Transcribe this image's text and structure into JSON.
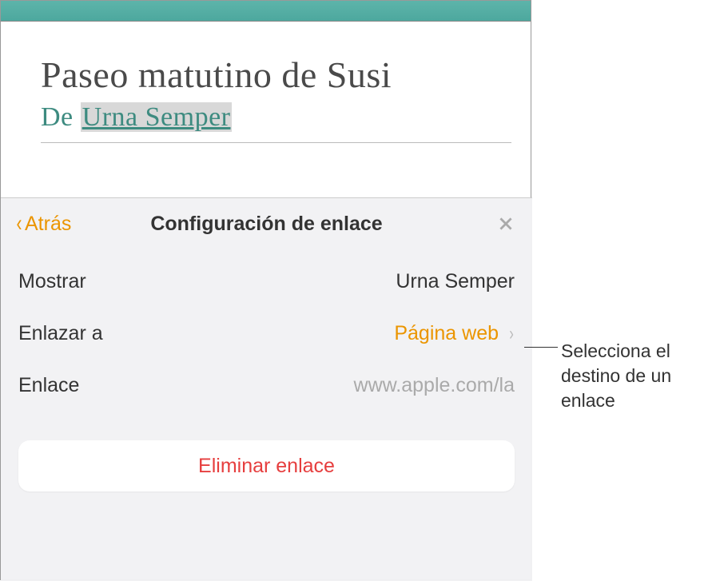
{
  "document": {
    "title": "Paseo matutino de Susi",
    "byline_prefix": "De ",
    "byline_author": "Urna Semper"
  },
  "popover": {
    "back_label": "Atrás",
    "title": "Configuración de enlace",
    "rows": {
      "display": {
        "label": "Mostrar",
        "value": "Urna Semper"
      },
      "link_to": {
        "label": "Enlazar a",
        "value": "Página web"
      },
      "link": {
        "label": "Enlace",
        "value": "www.apple.com/la"
      }
    },
    "remove_label": "Eliminar enlace"
  },
  "callout": {
    "text": "Selecciona el destino de un enlace"
  }
}
